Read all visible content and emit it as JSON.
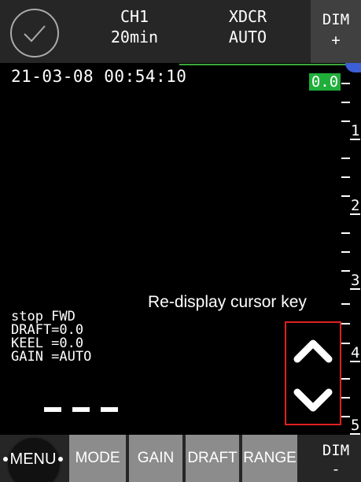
{
  "header": {
    "channel": "CH1",
    "interval": "20min",
    "xdcr_label": "XDCR",
    "xdcr_value": "AUTO",
    "dim_label": "DIM",
    "dim_plus": "+"
  },
  "screen": {
    "timestamp": "21-03-08 00:54:10",
    "depth_value": "0.0",
    "scale_labels": [
      "1",
      "2",
      "3",
      "4",
      "5"
    ],
    "caption": "Re-display cursor key",
    "status_lines": [
      "stop FWD",
      "DRAFT=0.0",
      "KEEL =0.0",
      "GAIN =AUTO"
    ]
  },
  "footer": {
    "menu": "MENU",
    "mode": "MODE",
    "gain": "GAIN",
    "draft": "DRAFT",
    "range": "RANGE",
    "dim_label": "DIM",
    "dim_minus": "-"
  },
  "colors": {
    "depth_highlight": "#1fae3a",
    "highlight_box": "#e02020"
  }
}
